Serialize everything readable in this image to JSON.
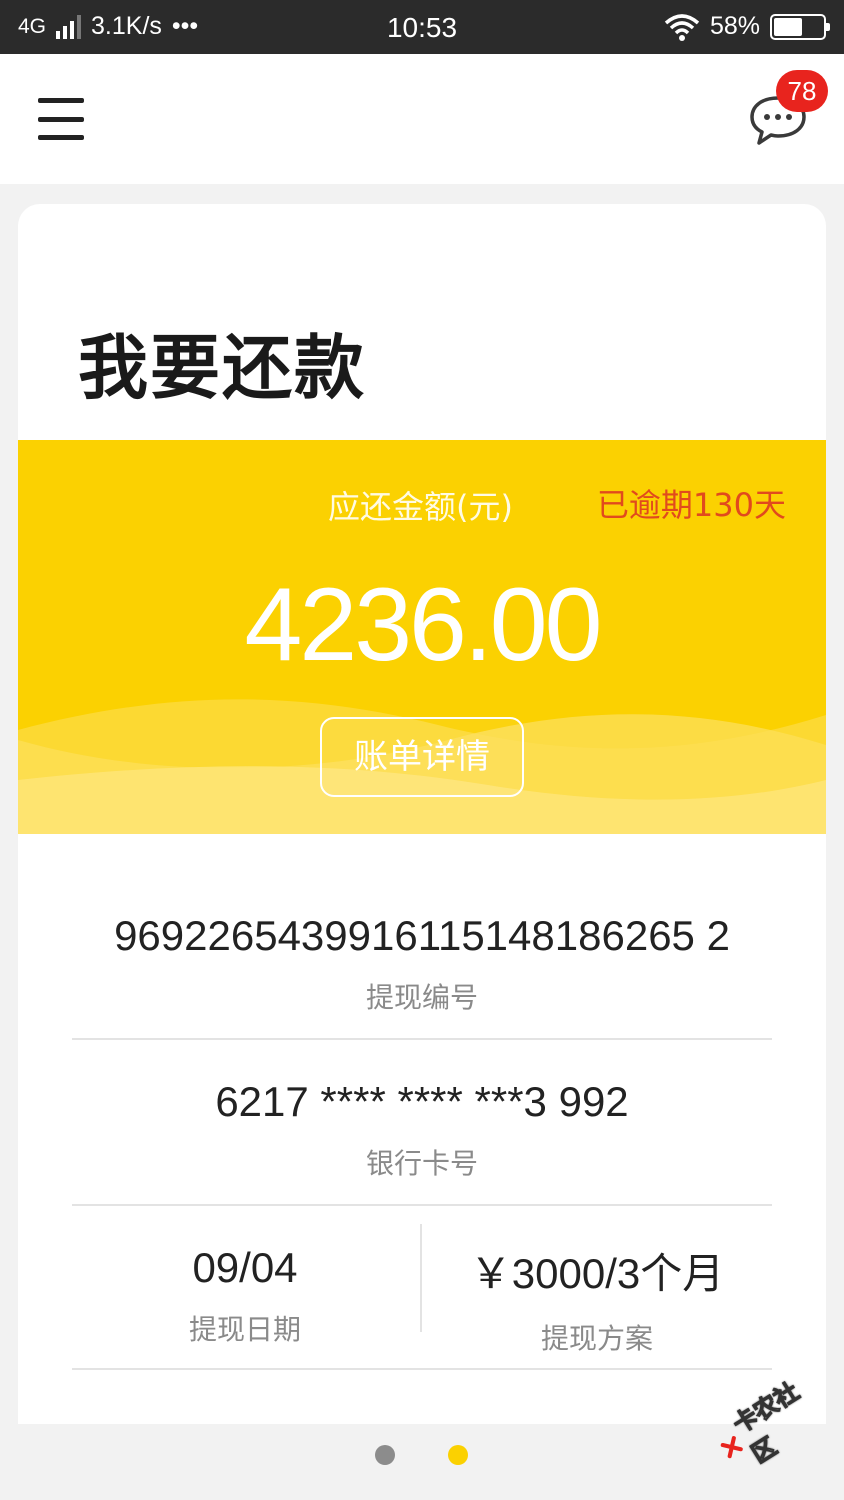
{
  "status_bar": {
    "network": "4G",
    "speed": "3.1K/s",
    "more": "•••",
    "time": "10:53",
    "battery_percent": "58%",
    "battery_level": 0.58
  },
  "top_nav": {
    "message_count": "78"
  },
  "repay": {
    "title": "我要还款",
    "due_label": "应还金额(元)",
    "overdue": "已逾期130天",
    "amount": "4236.00",
    "bill_button": "账单详情"
  },
  "details": {
    "withdrawal_no": {
      "value": "9692265439916115148186265 2",
      "label": "提现编号"
    },
    "bank_card": {
      "value": "6217 **** **** ***3 992",
      "label": "银行卡号"
    },
    "withdraw_date": {
      "value": "09/04",
      "label": "提现日期"
    },
    "plan": {
      "value": "￥3000/3个月",
      "label": "提现方案"
    }
  },
  "pager": {
    "count": 2,
    "active": 2
  },
  "watermark": {
    "text": "卡农社区"
  },
  "colors": {
    "accent_yellow": "#fbd101",
    "overdue_red": "#e14a1d",
    "badge_red": "#e8241e"
  }
}
